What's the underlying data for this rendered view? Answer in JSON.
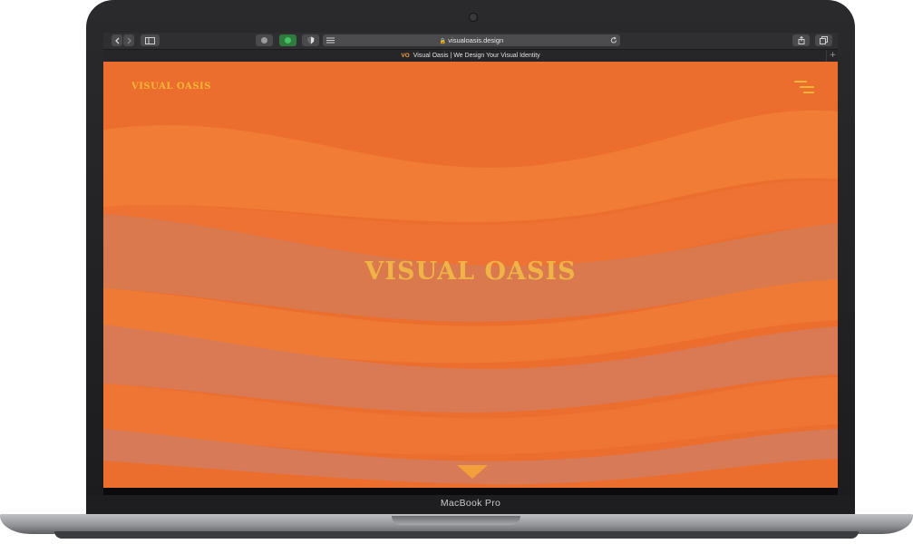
{
  "browser": {
    "url": "visualoasis.design",
    "tab_title": "Visual Oasis | We Design Your Visual Identity",
    "tab_favicon_text": "VO",
    "tab_add_label": "+",
    "toolbar_icons": [
      "back-icon",
      "forward-icon",
      "sidebar-icon",
      "privacy-icon",
      "extension-icon",
      "shield-icon",
      "reader-icon",
      "lock-icon",
      "reload-icon",
      "share-icon",
      "tabs-icon"
    ]
  },
  "page": {
    "brand_small": "VISUAL OASIS",
    "hero_title": "VISUAL OASIS",
    "menu_icon": "hamburger-menu-icon",
    "scroll_icon": "chevron-down-icon"
  },
  "device": {
    "model": "MacBook Pro"
  },
  "colors": {
    "page_background": "#ec6e2e",
    "wave_light": "#f08a3e",
    "wave_dark": "#d97a55",
    "brand_yellow": "#f2b636",
    "chrome_dark": "#2f2f31"
  }
}
